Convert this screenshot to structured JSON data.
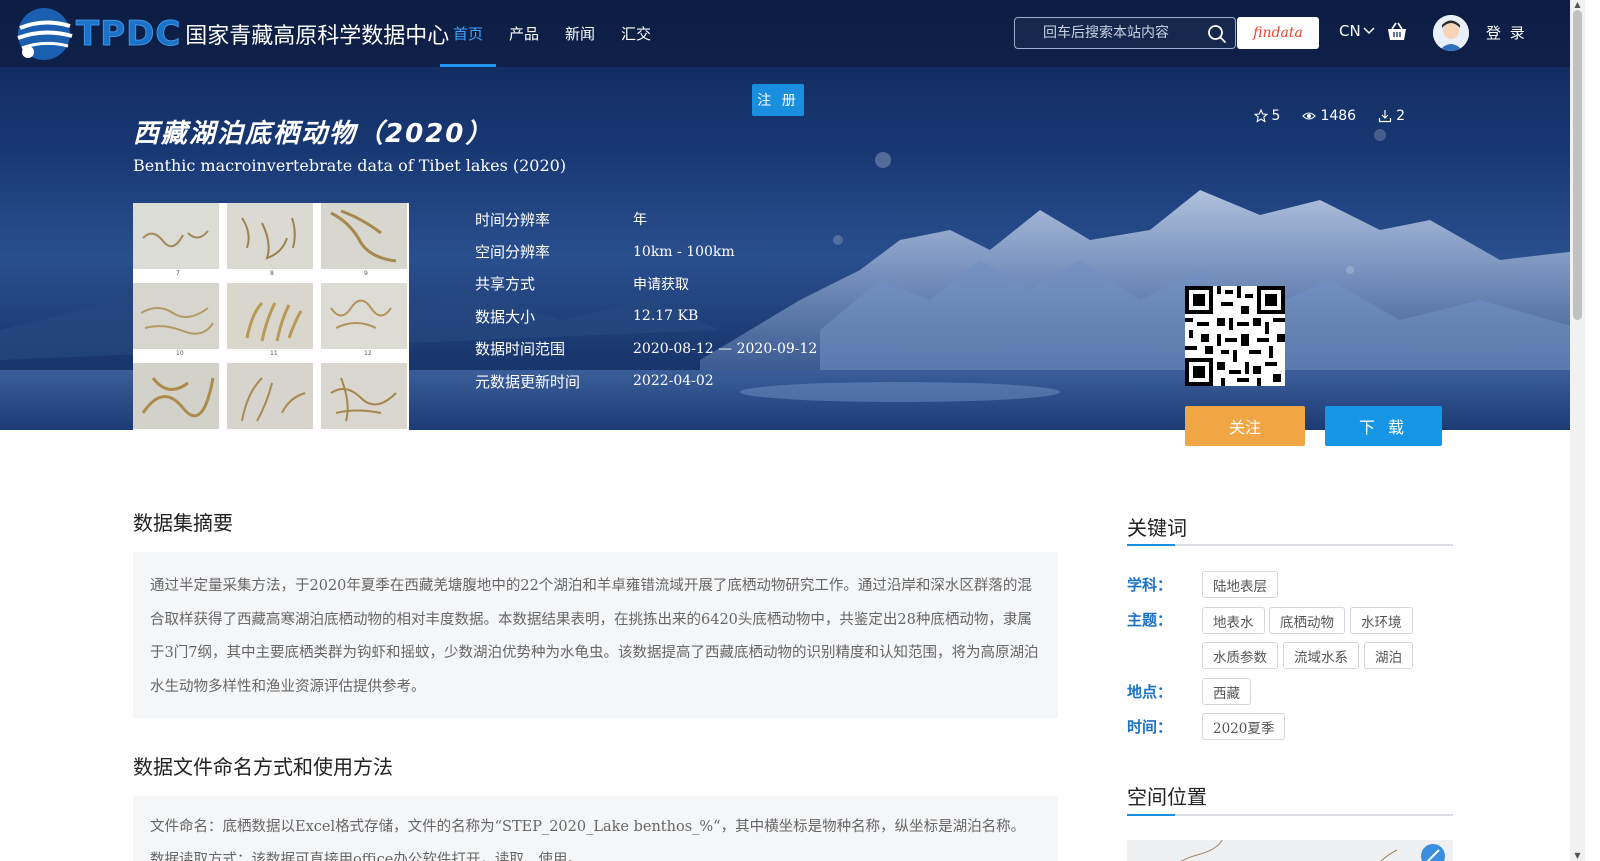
{
  "header": {
    "logo_abbr": "TPDC",
    "logo_name": "国家青藏高原科学数据中心",
    "nav": [
      {
        "label": "首页",
        "active": true
      },
      {
        "label": "产品",
        "active": false
      },
      {
        "label": "新闻",
        "active": false
      },
      {
        "label": "汇交",
        "active": false
      }
    ],
    "search_placeholder": "回车后搜索本站内容",
    "findata_label": "findata",
    "lang": "CN",
    "login": "登 录"
  },
  "register_label": "注 册",
  "dataset": {
    "title_cn": "西藏湖泊底栖动物（2020）",
    "title_en": "Benthic macroinvertebrate data of Tibet lakes (2020)",
    "stats": {
      "stars": "5",
      "views": "1486",
      "downloads": "2"
    },
    "thumb_labels": [
      "7",
      "8",
      "9",
      "10",
      "11",
      "12"
    ],
    "meta": [
      {
        "key": "时间分辨率",
        "value": "年"
      },
      {
        "key": "空间分辨率",
        "value": "10km - 100km"
      },
      {
        "key": "共享方式",
        "value": "申请获取"
      },
      {
        "key": "数据大小",
        "value": "12.17 KB"
      },
      {
        "key": "数据时间范围",
        "value": "2020-08-12 — 2020-09-12"
      },
      {
        "key": "元数据更新时间",
        "value": "2022-04-02"
      }
    ],
    "follow_label": "关注",
    "download_label": "下 载"
  },
  "abstract": {
    "title": "数据集摘要",
    "text": "通过半定量采集方法，于2020年夏季在西藏羌塘腹地中的22个湖泊和羊卓雍错流域开展了底栖动物研究工作。通过沿岸和深水区群落的混合取样获得了西藏高寒湖泊底栖动物的相对丰度数据。本数据结果表明，在挑拣出来的6420头底栖动物中，共鉴定出28种底栖动物，隶属于3门7纲，其中主要底栖类群为钩虾和摇蚊，少数湖泊优势种为水龟虫。该数据提高了西藏底栖动物的识别精度和认知范围，将为高原湖泊水生动物多样性和渔业资源评估提供参考。"
  },
  "naming": {
    "title": "数据文件命名方式和使用方法",
    "text": "文件命名：底栖数据以Excel格式存储，文件的名称为“STEP_2020_Lake benthos_%“，其中横坐标是物种名称，纵坐标是湖泊名称。 数据读取方式：该数据可直接用office办公软件打开，读取、使用。"
  },
  "keywords": {
    "title": "关键词",
    "subject_label": "学科：",
    "subject": [
      "陆地表层"
    ],
    "theme_label": "主题：",
    "theme": [
      "地表水",
      "底栖动物",
      "水环境",
      "水质参数",
      "流域水系",
      "湖泊"
    ],
    "place_label": "地点：",
    "place": [
      "西藏"
    ],
    "time_label": "时间：",
    "time": [
      "2020夏季"
    ]
  },
  "location": {
    "title": "空间位置"
  }
}
